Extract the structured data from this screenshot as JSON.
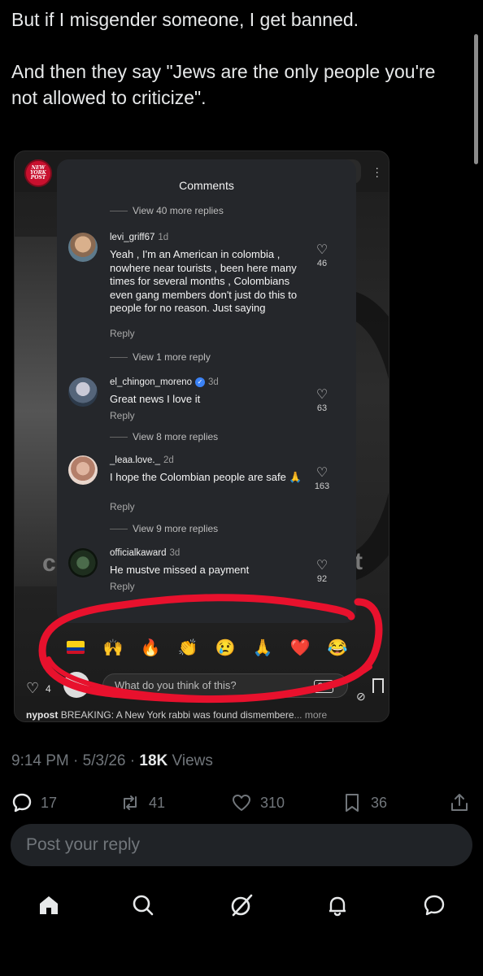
{
  "tweet": {
    "text": "But if I misgender someone, I get banned.\n\nAnd then they say \"Jews are the only people you're not allowed to criticize\"."
  },
  "embed": {
    "logo_text": "NEW YORK POST",
    "top_handle": "n",
    "comments_title": "Comments",
    "view_more_top": "View 40 more replies",
    "comments": [
      {
        "user": "levi_griff67",
        "age": "1d",
        "verified": false,
        "text": "Yeah , I'm an American in colombia , nowhere near tourists , been here many times for several months , Colombians even gang members don't just do this to people for no reason. Just saying",
        "reply": "Reply",
        "likes": "46",
        "more": "View 1 more reply"
      },
      {
        "user": "el_chingon_moreno",
        "age": "3d",
        "verified": true,
        "text": "Great news I love it",
        "reply": "Reply",
        "likes": "63",
        "more": "View 8 more replies"
      },
      {
        "user": "_leaa.love._",
        "age": "2d",
        "verified": false,
        "text": "I hope the Colombian people are safe 🙏",
        "reply": "Reply",
        "likes": "163",
        "more": "View 9 more replies"
      },
      {
        "user": "officialkaward",
        "age": "3d",
        "verified": false,
        "text": "He mustve missed a payment",
        "reply": "Reply",
        "likes": "92",
        "more": ""
      }
    ],
    "emoji_reactions": [
      "colombia-flag",
      "🙌",
      "🔥",
      "👏",
      "😢",
      "🙏",
      "❤️",
      "😂"
    ],
    "input_placeholder": "What do you think of this?",
    "gif_label": "GIF",
    "like_count_partial": "4",
    "caption_user": "nypost",
    "caption_text": "BREAKING: A New York rabbi was found dismembere",
    "caption_more": "... more",
    "scribble_color": "#e8112d"
  },
  "meta": {
    "time": "9:14 PM",
    "date": "5/3/26",
    "views_count": "18K",
    "views_label": "Views"
  },
  "actions": {
    "replies": "17",
    "reposts": "41",
    "likes": "310",
    "bookmarks": "36"
  },
  "reply_placeholder": "Post your reply",
  "nav": [
    "home-icon",
    "search-icon",
    "grok-icon",
    "notifications-icon",
    "messages-icon"
  ]
}
